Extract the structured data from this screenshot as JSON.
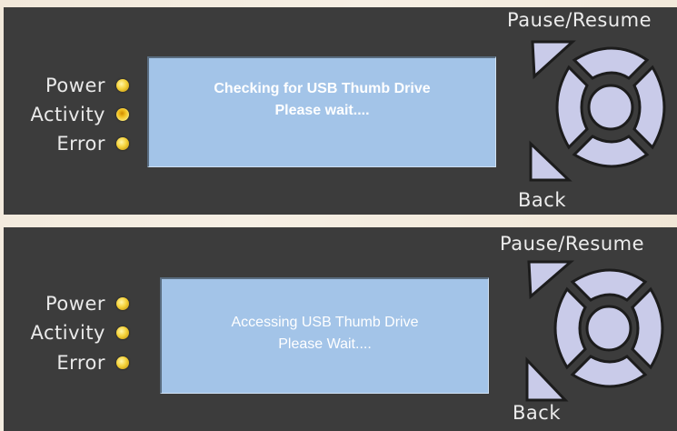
{
  "panels": [
    {
      "leds": [
        {
          "label": "Power",
          "state": "on"
        },
        {
          "label": "Activity",
          "state": "blinking"
        },
        {
          "label": "Error",
          "state": "on"
        }
      ],
      "display": {
        "line1": "Checking for USB Thumb Drive",
        "line2": "Please wait...."
      },
      "keypad": {
        "pause_resume_label": "Pause/Resume",
        "back_label": "Back"
      }
    },
    {
      "leds": [
        {
          "label": "Power",
          "state": "on"
        },
        {
          "label": "Activity",
          "state": "on"
        },
        {
          "label": "Error",
          "state": "on"
        }
      ],
      "display": {
        "line1": "Accessing USB Thumb Drive",
        "line2": "Please Wait...."
      },
      "keypad": {
        "pause_resume_label": "Pause/Resume",
        "back_label": "Back"
      }
    }
  ],
  "colors": {
    "panel_bg": "#3c3c3c",
    "lcd_bg": "#a3c4e8",
    "led_yellow": "#f5d23a",
    "key_fill": "#c9cbe9",
    "page_bg": "#f3ebde"
  }
}
